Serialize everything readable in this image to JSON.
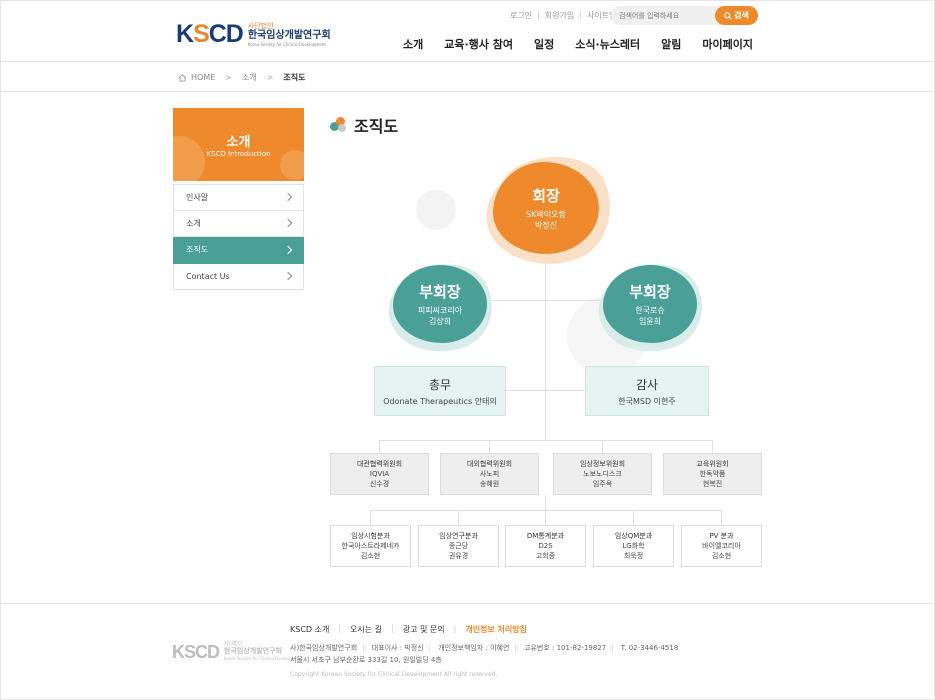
{
  "header": {
    "logo_mark_k": "K",
    "logo_mark_s": "S",
    "logo_mark_rest": "CD",
    "logo_sub": "사단법인",
    "logo_main": "한국임상개발연구회",
    "logo_en": "Korea Society for Clinical Development",
    "util": [
      "로그인",
      "회원가입",
      "사이트맵"
    ],
    "search_placeholder": "검색어를 입력하세요",
    "search_button": "검색",
    "nav": [
      "소개",
      "교육·행사 참여",
      "일정",
      "소식·뉴스레터",
      "알림",
      "마이페이지"
    ]
  },
  "breadcrumb": {
    "home": "HOME",
    "level1": "소개",
    "current": "조직도"
  },
  "sidebar": {
    "title": "소개",
    "subtitle": "KSCD Introduction",
    "items": [
      {
        "label": "인사말",
        "active": false
      },
      {
        "label": "소개",
        "active": false
      },
      {
        "label": "조직도",
        "active": true
      },
      {
        "label": "Contact Us",
        "active": false
      }
    ]
  },
  "content": {
    "title": "조직도"
  },
  "org": {
    "president": {
      "role": "회장",
      "org": "SK바이오팜",
      "name": "박정신"
    },
    "vp_left": {
      "role": "부회장",
      "org": "피피씨코리아",
      "name": "김상희"
    },
    "vp_right": {
      "role": "부회장",
      "org": "한국로슈",
      "name": "임윤희"
    },
    "secretary": {
      "role": "총무",
      "detail": "Odonate Therapeutics 안태의"
    },
    "auditor": {
      "role": "감사",
      "detail": "한국MSD 이현주"
    },
    "committees": [
      {
        "role": "대관협력위원회",
        "org": "IQVIA",
        "name": "신수경"
      },
      {
        "role": "대외협력위원회",
        "org": "사노피",
        "name": "송혜원"
      },
      {
        "role": "임상정보위원회",
        "org": "노보노디스크",
        "name": "임주옥"
      },
      {
        "role": "교육위원회",
        "org": "한독약품",
        "name": "현복진"
      }
    ],
    "divisions": [
      {
        "role": "임상시험분과",
        "org": "한국아스트라제네카",
        "name": "김소현"
      },
      {
        "role": "임상연구분과",
        "org": "종근당",
        "name": "권유경"
      },
      {
        "role": "DM통계분과",
        "org": "D2S",
        "name": "고희종"
      },
      {
        "role": "임상QM분과",
        "org": "LG화학",
        "name": "최욱정"
      },
      {
        "role": "PV 분과",
        "org": "바이엘코리아",
        "name": "김소현"
      }
    ]
  },
  "footer": {
    "links": [
      "KSCD 소개",
      "오시는 길",
      "광고 및 문의",
      "개인정보 처리방침"
    ],
    "info_line1": [
      "사)한국임상개발연구회",
      "대표이사 : 박정신",
      "개인정보책임자 : 이혜연",
      "고유번호 : 101-82-19827",
      "T. 02-3446-4518"
    ],
    "info_line2": "서울시 서초구 남부순환로 333길 10, 원일빌딩 4층",
    "copyright": "Copyright Korean Society for Clinical Development All right reserved."
  },
  "colors": {
    "orange": "#ee8a2c",
    "teal": "#4aa096",
    "navy": "#1a3a78"
  }
}
